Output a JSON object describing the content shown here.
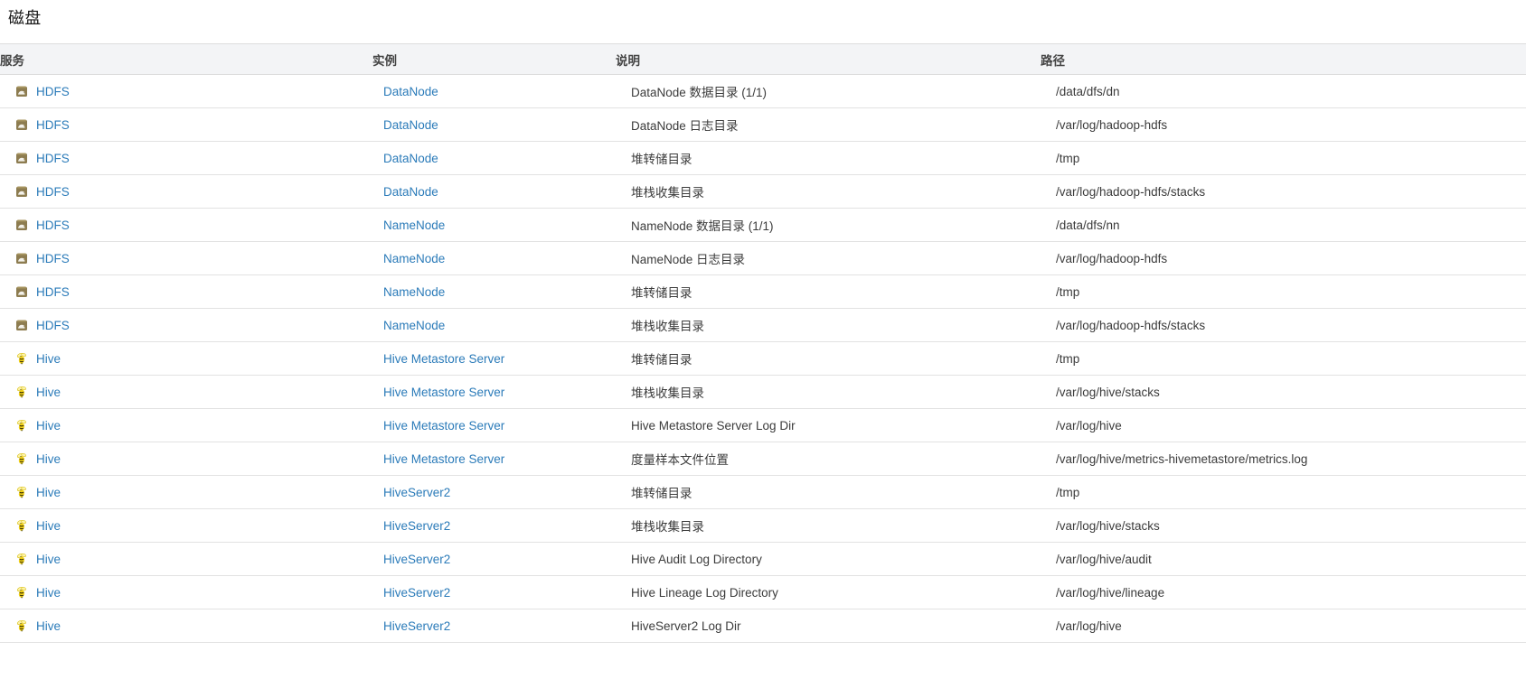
{
  "page": {
    "title": "磁盘"
  },
  "table": {
    "columns": [
      {
        "key": "service",
        "label": "服务"
      },
      {
        "key": "instance",
        "label": "实例"
      },
      {
        "key": "desc",
        "label": "说明"
      },
      {
        "key": "path",
        "label": "路径"
      }
    ],
    "rows": [
      {
        "icon": "hadoop-elephant-icon",
        "service": "HDFS",
        "instance": "DataNode",
        "desc": "DataNode 数据目录 (1/1)",
        "path": "/data/dfs/dn"
      },
      {
        "icon": "hadoop-elephant-icon",
        "service": "HDFS",
        "instance": "DataNode",
        "desc": "DataNode 日志目录",
        "path": "/var/log/hadoop-hdfs"
      },
      {
        "icon": "hadoop-elephant-icon",
        "service": "HDFS",
        "instance": "DataNode",
        "desc": "堆转储目录",
        "path": "/tmp"
      },
      {
        "icon": "hadoop-elephant-icon",
        "service": "HDFS",
        "instance": "DataNode",
        "desc": "堆栈收集目录",
        "path": "/var/log/hadoop-hdfs/stacks"
      },
      {
        "icon": "hadoop-elephant-icon",
        "service": "HDFS",
        "instance": "NameNode",
        "desc": "NameNode 数据目录 (1/1)",
        "path": "/data/dfs/nn"
      },
      {
        "icon": "hadoop-elephant-icon",
        "service": "HDFS",
        "instance": "NameNode",
        "desc": "NameNode 日志目录",
        "path": "/var/log/hadoop-hdfs"
      },
      {
        "icon": "hadoop-elephant-icon",
        "service": "HDFS",
        "instance": "NameNode",
        "desc": "堆转储目录",
        "path": "/tmp"
      },
      {
        "icon": "hadoop-elephant-icon",
        "service": "HDFS",
        "instance": "NameNode",
        "desc": "堆栈收集目录",
        "path": "/var/log/hadoop-hdfs/stacks"
      },
      {
        "icon": "hive-bee-icon",
        "service": "Hive",
        "instance": "Hive Metastore Server",
        "desc": "堆转储目录",
        "path": "/tmp"
      },
      {
        "icon": "hive-bee-icon",
        "service": "Hive",
        "instance": "Hive Metastore Server",
        "desc": "堆栈收集目录",
        "path": "/var/log/hive/stacks"
      },
      {
        "icon": "hive-bee-icon",
        "service": "Hive",
        "instance": "Hive Metastore Server",
        "desc": "Hive Metastore Server Log Dir",
        "path": "/var/log/hive"
      },
      {
        "icon": "hive-bee-icon",
        "service": "Hive",
        "instance": "Hive Metastore Server",
        "desc": "度量样本文件位置",
        "path": "/var/log/hive/metrics-hivemetastore/metrics.log"
      },
      {
        "icon": "hive-bee-icon",
        "service": "Hive",
        "instance": "HiveServer2",
        "desc": "堆转储目录",
        "path": "/tmp"
      },
      {
        "icon": "hive-bee-icon",
        "service": "Hive",
        "instance": "HiveServer2",
        "desc": "堆栈收集目录",
        "path": "/var/log/hive/stacks"
      },
      {
        "icon": "hive-bee-icon",
        "service": "Hive",
        "instance": "HiveServer2",
        "desc": "Hive Audit Log Directory",
        "path": "/var/log/hive/audit"
      },
      {
        "icon": "hive-bee-icon",
        "service": "Hive",
        "instance": "HiveServer2",
        "desc": "Hive Lineage Log Directory",
        "path": "/var/log/hive/lineage"
      },
      {
        "icon": "hive-bee-icon",
        "service": "Hive",
        "instance": "HiveServer2",
        "desc": "HiveServer2 Log Dir",
        "path": "/var/log/hive"
      }
    ]
  },
  "colors": {
    "link": "#2b7bb9",
    "header_bg": "#f3f4f6",
    "row_border": "#e2e2e2",
    "text": "#3b3b3b",
    "hdfs_icon": "#8a7a4e",
    "hive_icon": "#f2d117"
  }
}
